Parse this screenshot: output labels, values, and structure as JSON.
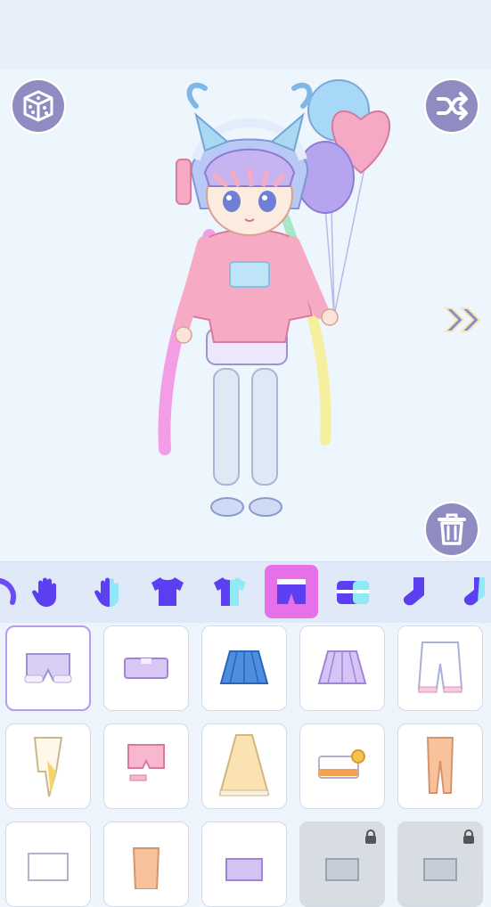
{
  "toolbar": {
    "random_icon": "dice-icon",
    "shuffle_icon": "shuffle-icon",
    "delete_icon": "trash-icon",
    "next_icon": "double-chevron-right-icon"
  },
  "categories": [
    {
      "icon": "sparkle-icon"
    },
    {
      "icon": "glove-icon"
    },
    {
      "icon": "glove-alt-icon"
    },
    {
      "icon": "tshirt-icon"
    },
    {
      "icon": "tshirt-alt-icon"
    },
    {
      "icon": "shorts-icon",
      "selected": true
    },
    {
      "icon": "skirt-icon"
    },
    {
      "icon": "sock-icon"
    },
    {
      "icon": "sock-alt-icon"
    }
  ],
  "items": [
    {
      "kind": "lavender-shorts",
      "selected": true,
      "locked": false
    },
    {
      "kind": "lilac-mini-skirt",
      "locked": false
    },
    {
      "kind": "blue-pleated-skirt",
      "locked": false
    },
    {
      "kind": "lilac-pleated-skirt",
      "locked": false
    },
    {
      "kind": "white-bloomers",
      "locked": false
    },
    {
      "kind": "yellow-wrap-skirt",
      "locked": false
    },
    {
      "kind": "pink-garter-shorts",
      "locked": false
    },
    {
      "kind": "peach-tulle-skirt",
      "locked": false
    },
    {
      "kind": "bow-mini-skirt",
      "locked": false
    },
    {
      "kind": "orange-pants",
      "locked": false
    },
    {
      "kind": "white-shorts",
      "locked": false
    },
    {
      "kind": "orange-pants-alt",
      "locked": false
    },
    {
      "kind": "purple-shorts",
      "locked": false
    },
    {
      "kind": "grey-pants",
      "locked": true
    },
    {
      "kind": "grey-pants-alt",
      "locked": true
    }
  ],
  "colors": {
    "accent": "#e76fe7",
    "button": "#8f8cc2",
    "icon": "#5b3ff0",
    "selected_border": "#b49cf0"
  }
}
